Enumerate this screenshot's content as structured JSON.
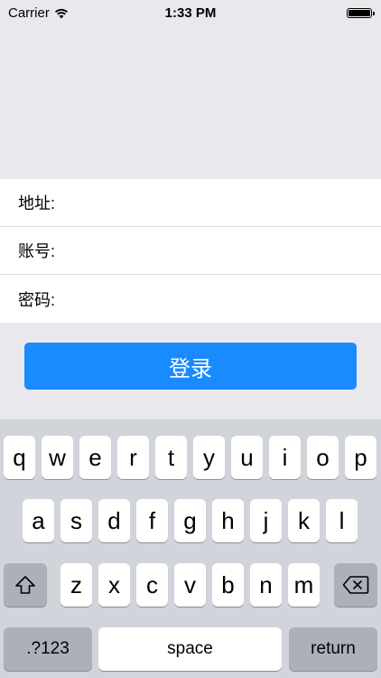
{
  "status_bar": {
    "carrier": "Carrier",
    "time": "1:33 PM"
  },
  "form": {
    "address_label": "地址:",
    "account_label": "账号:",
    "password_label": "密码:",
    "address_value": "",
    "account_value": "",
    "password_value": ""
  },
  "login_button_label": "登录",
  "keyboard": {
    "row1": [
      "q",
      "w",
      "e",
      "r",
      "t",
      "y",
      "u",
      "i",
      "o",
      "p"
    ],
    "row2": [
      "a",
      "s",
      "d",
      "f",
      "g",
      "h",
      "j",
      "k",
      "l"
    ],
    "row3": [
      "z",
      "x",
      "c",
      "v",
      "b",
      "n",
      "m"
    ],
    "numbers_key": ".?123",
    "space_key": "space",
    "return_key": "return",
    "shift_icon": "shift-icon",
    "delete_icon": "backspace-icon"
  },
  "colors": {
    "accent": "#1a8bff",
    "background": "#e8e8ed",
    "keyboard_background": "#d1d4da"
  }
}
